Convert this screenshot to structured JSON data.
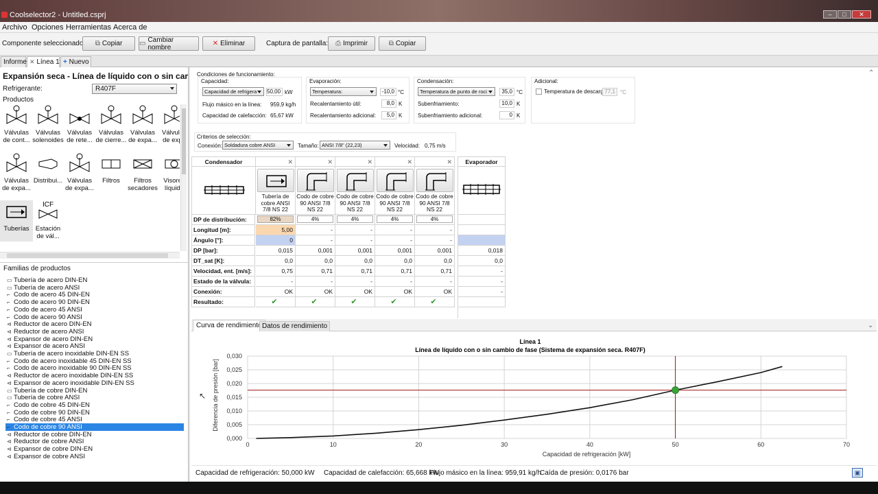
{
  "window": {
    "title": "Coolselector2 - Untitled.csprj"
  },
  "menu": [
    "Archivo",
    "Opciones",
    "Herramientas",
    "Acerca de"
  ],
  "toolbar": {
    "selected_label": "Componente seleccionado:",
    "copy": "Copiar",
    "rename": "Cambiar nombre",
    "delete": "Eliminar",
    "screenshot_label": "Captura de pantalla:",
    "print": "Imprimir",
    "copy2": "Copiar"
  },
  "tabs": {
    "report": "Informe",
    "line1": "Línea 1",
    "new": "Nuevo"
  },
  "left": {
    "title": "Expansión seca - Línea de líquido con o sin cambio",
    "refrigerant_label": "Refrigerante:",
    "refrigerant_value": "R407F",
    "products_label": "Productos",
    "products": [
      {
        "l1": "Válvulas",
        "l2": "de cont...",
        "icon": "control-valve-icon"
      },
      {
        "l1": "Válvulas",
        "l2": "solenoides",
        "icon": "solenoid-valve-icon"
      },
      {
        "l1": "Válvulas",
        "l2": "de rete...",
        "icon": "check-valve-icon"
      },
      {
        "l1": "Válvulas",
        "l2": "de cierre...",
        "icon": "shutoff-valve-icon"
      },
      {
        "l1": "Válvulas",
        "l2": "de expa...",
        "icon": "expansion-valve-icon"
      },
      {
        "l1": "Válvulas",
        "l2": "de expa",
        "icon": "expansion-valve-2-icon"
      },
      {
        "l1": "Válvulas",
        "l2": "de expa...",
        "icon": "hand-valve-icon"
      },
      {
        "l1": "Distribui...",
        "l2": "",
        "icon": "distributor-icon"
      },
      {
        "l1": "Válvulas",
        "l2": "de expa...",
        "icon": "expansion-valve-3-icon"
      },
      {
        "l1": "Filtros",
        "l2": "",
        "icon": "filter-icon"
      },
      {
        "l1": "Filtros",
        "l2": "secadores",
        "icon": "filter-drier-icon"
      },
      {
        "l1": "Visores",
        "l2": "líquido",
        "icon": "sight-glass-icon"
      },
      {
        "l1": "Tuberías",
        "l2": "",
        "icon": "pipe-icon"
      },
      {
        "l1": "Estación",
        "l2": "de vál...",
        "icon": "icf-station-icon",
        "badge": "ICF"
      }
    ],
    "families_label": "Familias de productos",
    "families": [
      "Tubería de acero DIN-EN",
      "Tubería de acero ANSI",
      "Codo de acero 45 DIN-EN",
      "Codo de acero 90 DIN-EN",
      "Codo de acero 45 ANSI",
      "Codo de acero 90 ANSI",
      "Reductor de acero DIN-EN",
      "Reductor de acero ANSI",
      "Expansor de acero DIN-EN",
      "Expansor de acero ANSI",
      "Tubería de acero inoxidable DIN-EN SS",
      "Codo de acero inoxidable 45 DIN-EN SS",
      "Codo de acero inoxidable 90 DIN-EN SS",
      "Reductor de acero inoxidable DIN-EN SS",
      "Expansor de acero inoxidable DIN-EN SS",
      "Tubería de cobre DIN-EN",
      "Tubería de cobre ANSI",
      "Codo de cobre 45 DIN-EN",
      "Codo de cobre 90 DIN-EN",
      "Codo de cobre 45 ANSI",
      "Codo de cobre 90 ANSI",
      "Reductor de cobre DIN-EN",
      "Reductor de cobre ANSI",
      "Expansor de cobre DIN-EN",
      "Expansor de cobre ANSI"
    ],
    "selected_family": "Codo de cobre 90 ANSI"
  },
  "conditions": {
    "title": "Condiciones de funcionamiento:",
    "capacity": {
      "title": "Capacidad:",
      "dropdown": "Capacidad de refrigera",
      "value": "50,00",
      "unit": "kW",
      "mass_flow_label": "Flujo másico en la línea:",
      "mass_flow": "959,9 kg/h",
      "heating_label": "Capacidad de calefacción:",
      "heating": "65,67 kW"
    },
    "evaporation": {
      "title": "Evaporación:",
      "dropdown": "Temperatura:",
      "value": "-10,0",
      "unit": "°C",
      "sh_useful_label": "Recalentamiento útil:",
      "sh_useful": "8,0",
      "sh_useful_unit": "K",
      "sh_add_label": "Recalentamiento adicional:",
      "sh_add": "5,0",
      "sh_add_unit": "K"
    },
    "condensation": {
      "title": "Condensación:",
      "dropdown": "Temperatura de punto de roci",
      "value": "35,0",
      "unit": "°C",
      "subcool_label": "Subenfriamiento:",
      "subcool": "10,0",
      "subcool_unit": "K",
      "subcool_add_label": "Subenfriamiento adicional:",
      "subcool_add": "0",
      "subcool_add_unit": "K"
    },
    "additional": {
      "title": "Adicional:",
      "discharge_label": "Temperatura de descarga",
      "discharge_value": "77,1",
      "discharge_unit": "°C"
    }
  },
  "selection": {
    "title": "Criterios de selección:",
    "connection_label": "Conexión:",
    "connection": "Soldadura cobre ANSI",
    "size_label": "Tamaño:",
    "size": "ANSI 7/8\" (22,23)",
    "velocity_label": "Velocidad:",
    "velocity": "0,75 m/s"
  },
  "grid": {
    "condenser": "Condensador",
    "evaporator": "Evaporador",
    "rows": [
      "DP de distribución:",
      "Longitud [m]:",
      "Ángulo [°]:",
      "DP [bar]:",
      "DT_sat [K]:",
      "Velocidad, ent. [m/s]:",
      "Estado de la válvula:",
      "Conexión:",
      "Resultado:"
    ],
    "components": [
      {
        "l1": "Tubería de",
        "l2": "cobre ANSI",
        "l3": "7/8 NS 22",
        "dist": "82%",
        "len": "5,00",
        "angle": "0",
        "dp": "0,015",
        "dt": "0,0",
        "vel": "0,75",
        "valve": "-",
        "conn": "OK",
        "res": "✔"
      },
      {
        "l1": "Codo de cobre",
        "l2": "90 ANSI 7/8",
        "l3": "NS 22",
        "dist": "4%",
        "len": "-",
        "angle": "-",
        "dp": "0,001",
        "dt": "0,0",
        "vel": "0,71",
        "valve": "-",
        "conn": "OK",
        "res": "✔"
      },
      {
        "l1": "Codo de cobre",
        "l2": "90 ANSI 7/8",
        "l3": "NS 22",
        "dist": "4%",
        "len": "-",
        "angle": "-",
        "dp": "0,001",
        "dt": "0,0",
        "vel": "0,71",
        "valve": "-",
        "conn": "OK",
        "res": "✔"
      },
      {
        "l1": "Codo de cobre",
        "l2": "90 ANSI 7/8",
        "l3": "NS 22",
        "dist": "4%",
        "len": "-",
        "angle": "-",
        "dp": "0,001",
        "dt": "0,0",
        "vel": "0,71",
        "valve": "-",
        "conn": "OK",
        "res": "✔"
      },
      {
        "l1": "Codo de cobre",
        "l2": "90 ANSI 7/8",
        "l3": "NS 22",
        "dist": "4%",
        "len": "-",
        "angle": "-",
        "dp": "0,001",
        "dt": "0,0",
        "vel": "0,71",
        "valve": "-",
        "conn": "OK",
        "res": "✔"
      }
    ],
    "evap_dp": "0,018",
    "evap_dt": "0,0",
    "evap_vel": "-",
    "evap_valve": "-",
    "evap_conn": "-"
  },
  "chart_tabs": [
    "Curva de rendimiento",
    "Datos de rendimiento"
  ],
  "chart_data": {
    "type": "line",
    "title": "Línea 1",
    "subtitle": "Línea de líquido con o sin cambio de fase (Sistema de expansión seca. R407F)",
    "xlabel": "Capacidad de refrigeración [kW]",
    "ylabel": "Diferencia de presión [bar]",
    "xlim": [
      0,
      70
    ],
    "ylim": [
      0,
      0.03
    ],
    "xticks": [
      "0",
      "10",
      "20",
      "30",
      "40",
      "50",
      "60",
      "70"
    ],
    "yticks": [
      "0,000",
      "0,005",
      "0,010",
      "0,015",
      "0,020",
      "0,025",
      "0,030"
    ],
    "grid": true,
    "x": [
      1,
      5,
      10,
      15,
      20,
      25,
      30,
      35,
      40,
      45,
      50,
      55,
      60,
      62.5
    ],
    "y": [
      0,
      0.0003,
      0.0009,
      0.0019,
      0.0032,
      0.0048,
      0.0067,
      0.0088,
      0.0112,
      0.0141,
      0.0176,
      0.0207,
      0.024,
      0.0262
    ],
    "operating_point": {
      "x": 50,
      "y": 0.0176
    },
    "colors": {
      "curve": "#111111",
      "crosshair": "#a31515",
      "point": "#3aa33a"
    }
  },
  "status": {
    "capacity": "Capacidad de refrigeración: 50,000 kW",
    "heating": "Capacidad de calefacción: 65,668 kW",
    "mass_flow": "Flujo másico en la línea: 959,91 kg/h",
    "pressure_drop": "Caída de presión: 0,0176 bar"
  }
}
